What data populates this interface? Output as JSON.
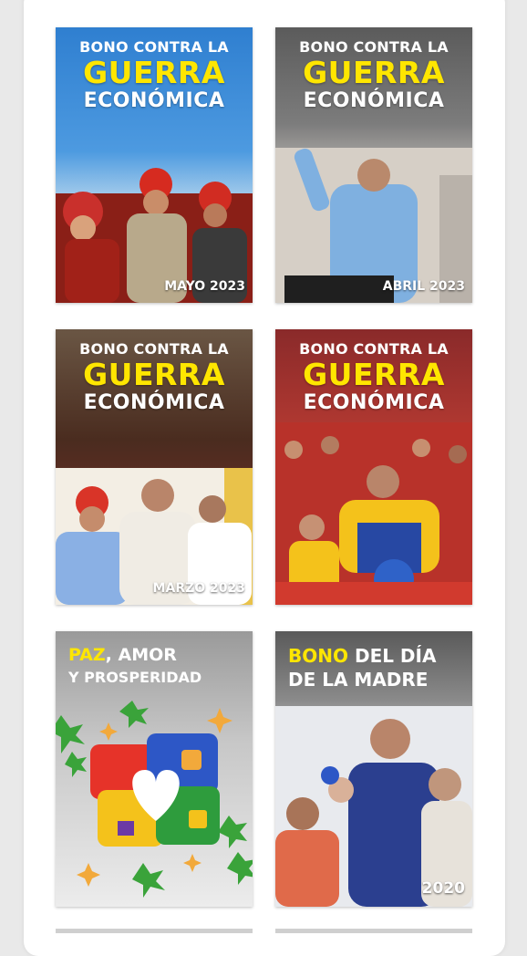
{
  "cards": [
    {
      "line1": "BONO CONTRA LA",
      "line2": "GUERRA",
      "line3": "ECONÓMICA",
      "date": "MAYO 2023"
    },
    {
      "line1": "BONO CONTRA LA",
      "line2": "GUERRA",
      "line3": "ECONÓMICA",
      "date": "ABRIL 2023"
    },
    {
      "line1": "BONO CONTRA LA",
      "line2": "GUERRA",
      "line3": "ECONÓMICA",
      "date": "MARZO 2023"
    },
    {
      "line1": "BONO CONTRA LA",
      "line2": "GUERRA",
      "line3": "ECONÓMICA",
      "date": ""
    },
    {
      "paz": "PAZ",
      "amor": ", AMOR",
      "prosperidad": "Y PROSPERIDAD"
    },
    {
      "bono": "BONO",
      "del_dia": " DEL DÍA",
      "madre": "DE LA MADRE",
      "date": "2020"
    }
  ]
}
